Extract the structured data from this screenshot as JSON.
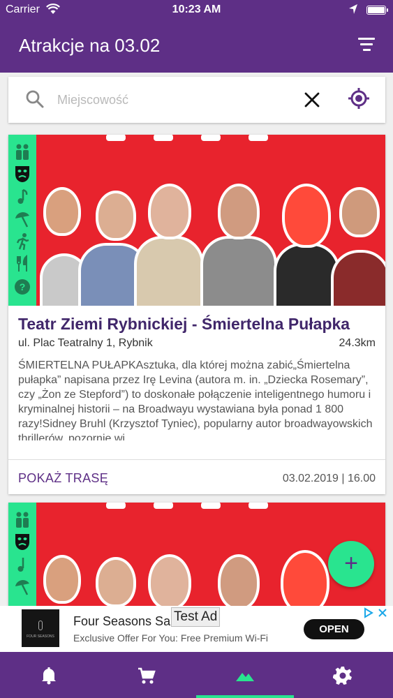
{
  "status_bar": {
    "carrier": "Carrier",
    "time": "10:23 AM"
  },
  "header": {
    "title": "Atrakcje na 03.02"
  },
  "search": {
    "placeholder": "Miejscowość",
    "value": ""
  },
  "categories": [
    "people-icon",
    "theater-masks-icon",
    "music-note-icon",
    "beach-umbrella-icon",
    "running-icon",
    "restaurant-icon",
    "help-icon"
  ],
  "events": [
    {
      "name": "Teatr Ziemi Rybnickiej - Śmiertelna Pułapka",
      "address": "ul. Plac Teatralny 1, Rybnik",
      "distance": "24.3km",
      "description": "ŚMIERTELNA PUŁAPKAsztuka, dla której można zabić„Śmiertelna pułapka” napisana przez Irę Levina (autora m. in. „Dziecka Rosemary”, czy „Żon ze Stepford”) to doskonałe połączenie inteligentnego humoru i kryminalnej historii – na Broadwayu wystawiana była ponad 1 800 razy!Sidney Bruhl (Krzysztof Tyniec), popularny autor broadwayowskich thrillerów, pozornie wi...",
      "route_label": "POKAŻ TRASĘ",
      "datetime": "03.02.2019 | 16.00"
    }
  ],
  "fab": {
    "label": "+"
  },
  "ad": {
    "badge": "Test Ad",
    "title": "Four Seasons Sar",
    "subtitle": "Exclusive Offer For You: Free Premium Wi-Fi",
    "cta": "OPEN",
    "logo_text": "FOUR SEASONS"
  },
  "bottom_nav": [
    {
      "icon": "bell-icon",
      "active": false
    },
    {
      "icon": "cart-icon",
      "active": false
    },
    {
      "icon": "mountains-icon",
      "active": true
    },
    {
      "icon": "settings-icon",
      "active": false
    }
  ],
  "colors": {
    "primary": "#5e2f86",
    "accent": "#29e48f",
    "poster_red": "#e8232d"
  }
}
